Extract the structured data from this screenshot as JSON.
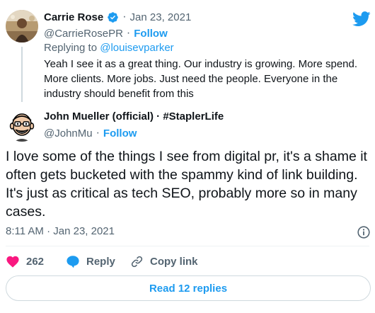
{
  "reply_tweet": {
    "author_name": "Carrie Rose",
    "verified_icon": "verified-badge-icon",
    "date": "Jan 23, 2021",
    "handle": "@CarrieRosePR",
    "follow_label": "Follow",
    "replying_prefix": "Replying to",
    "replying_handle": "@louisevparker",
    "text": "Yeah I see it as a great thing. Our industry is growing. More spend. More clients. More jobs. Just need the people. Everyone in the industry should benefit from this"
  },
  "main_tweet": {
    "author_name": "John Mueller (official) · #StaplerLife",
    "handle": "@JohnMu",
    "follow_label": "Follow",
    "text": "I love some of the things I see from digital pr, it's a shame it often gets bucketed with the spammy kind of link building. It's just as critical as tech SEO, probably more so in many cases.",
    "timestamp": "8:11 AM · Jan 23, 2021"
  },
  "actions": {
    "like_count": "262",
    "reply_label": "Reply",
    "copy_label": "Copy link"
  },
  "read_replies_label": "Read 12 replies",
  "icons": {
    "twitter": "twitter-bird-icon",
    "info": "info-icon",
    "heart": "heart-icon",
    "reply": "reply-bubble-icon",
    "link": "link-icon"
  },
  "colors": {
    "accent": "#1d9bf0",
    "like": "#f91880",
    "muted": "#536471"
  }
}
